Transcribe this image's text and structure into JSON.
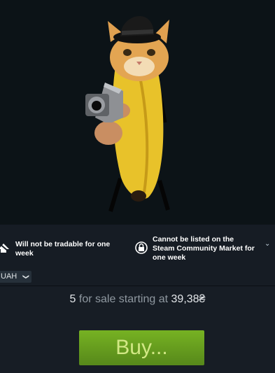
{
  "artwork": {
    "icon": "banana-cat-gun-image"
  },
  "notices": {
    "trade": {
      "icon": "trade-restricted-icon",
      "text": "Will not be tradable for one week"
    },
    "market": {
      "icon": "market-restricted-icon",
      "text": "Cannot be listed on the Steam Community Market for one week"
    }
  },
  "currency": {
    "selected": "UAH"
  },
  "sale": {
    "count": "5",
    "mid_text": "for sale starting at",
    "price": "39,38₴"
  },
  "buy": {
    "label": "Buy..."
  },
  "colors": {
    "buy_green": "#75b022",
    "buy_text": "#d2e885",
    "background": "#171d25"
  }
}
